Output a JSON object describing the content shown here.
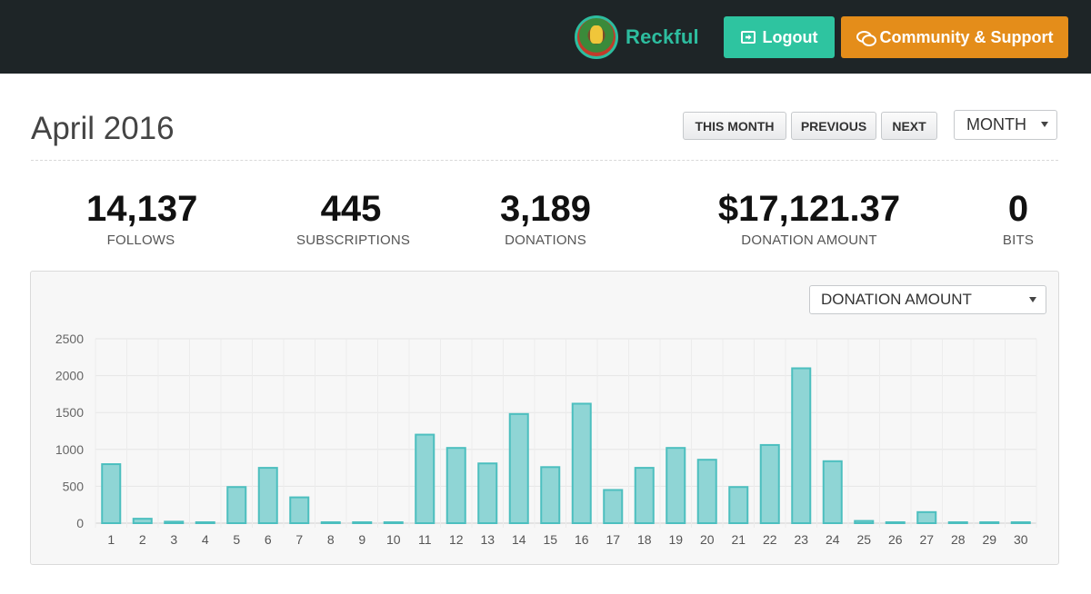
{
  "header": {
    "brand_name": "Reckful",
    "logout_label": "Logout",
    "community_label": "Community & Support",
    "logout_icon": "logout-icon",
    "community_icon": "chat-bubbles-icon",
    "accent_teal": "#2ec4a0",
    "accent_orange": "#e48d1a"
  },
  "page": {
    "title": "April 2016",
    "this_month_label": "THIS MONTH",
    "previous_label": "PREVIOUS",
    "next_label": "NEXT",
    "period_select": "MONTH"
  },
  "stats": [
    {
      "value": "14,137",
      "label": "FOLLOWS"
    },
    {
      "value": "445",
      "label": "SUBSCRIPTIONS"
    },
    {
      "value": "3,189",
      "label": "DONATIONS"
    },
    {
      "value": "$17,121.37",
      "label": "DONATION AMOUNT"
    },
    {
      "value": "0",
      "label": "BITS"
    }
  ],
  "chart": {
    "metric_select": "DONATION AMOUNT"
  },
  "chart_data": {
    "type": "bar",
    "categories": [
      "1",
      "2",
      "3",
      "4",
      "5",
      "6",
      "7",
      "8",
      "9",
      "10",
      "11",
      "12",
      "13",
      "14",
      "15",
      "16",
      "17",
      "18",
      "19",
      "20",
      "21",
      "22",
      "23",
      "24",
      "25",
      "26",
      "27",
      "28",
      "29",
      "30"
    ],
    "values": [
      800,
      60,
      20,
      10,
      490,
      750,
      350,
      10,
      10,
      10,
      1200,
      1020,
      810,
      1480,
      760,
      1620,
      450,
      750,
      1020,
      860,
      490,
      1060,
      2100,
      840,
      30,
      10,
      150,
      10,
      10,
      10
    ],
    "yticks": [
      0,
      500,
      1000,
      1500,
      2000,
      2500
    ],
    "ylim": [
      0,
      2500
    ],
    "grid": true,
    "bar_fill": "#8fd5d5",
    "bar_stroke": "#4cbfbf"
  }
}
